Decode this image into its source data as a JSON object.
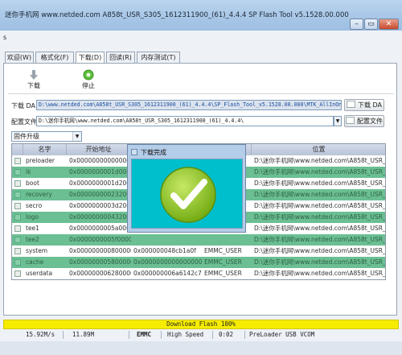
{
  "window": {
    "title": "迷你手机网 www.netded.com   A858t_USR_S305_1612311900_(61)_4.4.4  SP Flash Tool v5.1528.00.000",
    "menu_hint": "s"
  },
  "tabs": [
    {
      "label": "欢迎(W)"
    },
    {
      "label": "格式化(F)"
    },
    {
      "label": "下载(D)",
      "active": true
    },
    {
      "label": "回读(R)"
    },
    {
      "label": "内存测试(T)"
    }
  ],
  "toolbar": {
    "download_label": "下载",
    "stop_label": "停止"
  },
  "download_agent": {
    "label": "下载 DA",
    "path": "D:\\www.netded.com\\A858t_USR_S305_1612311900_(61)_4.4.4\\SP_Flash_Tool_v5.1528.00.000\\MTK_AllInOne_DA.bin",
    "button": "下载 DA"
  },
  "scatter": {
    "label": "配置文件",
    "path": "D:\\迷你手机网\\www.netded.com\\A858t_USR_S305_1612311900_(61)_4.4.4\\",
    "button": "配置文件"
  },
  "mode": {
    "selected": "固件升级"
  },
  "table": {
    "headers": [
      "名字",
      "开始地址",
      "",
      "",
      "位置"
    ],
    "rows": [
      {
        "name": "preloader",
        "start": "0x0000000000000000",
        "size": "",
        "region": "",
        "location": "D:\\迷你手机网\\www.netded.com\\A858t_USR_S3..."
      },
      {
        "name": "lk",
        "start": "0x0000000001d00000",
        "size": "",
        "region": "",
        "location": "D:\\迷你手机网\\www.netded.com\\A858t_USR_S3..."
      },
      {
        "name": "boot",
        "start": "0x0000000001d20000",
        "size": "",
        "region": "",
        "location": "D:\\迷你手机网\\www.netded.com\\A858t_USR_S3..."
      },
      {
        "name": "recovery",
        "start": "0x0000000002320000",
        "size": "",
        "region": "",
        "location": "D:\\迷你手机网\\www.netded.com\\A858t_USR_S3..."
      },
      {
        "name": "secro",
        "start": "0x0000000003d20000",
        "size": "",
        "region": "",
        "location": "D:\\迷你手机网\\www.netded.com\\A858t_USR_S3..."
      },
      {
        "name": "logo",
        "start": "0x0000000004320000",
        "size": "",
        "region": "",
        "location": "D:\\迷你手机网\\www.netded.com\\A858t_USR_S3..."
      },
      {
        "name": "tee1",
        "start": "0x0000000005a0000",
        "size": "",
        "region": "",
        "location": "D:\\迷你手机网\\www.netded.com\\A858t_USR_S3..."
      },
      {
        "name": "tee2",
        "start": "0x0000000005f00000",
        "size": "",
        "region": "",
        "location": "D:\\迷你手机网\\www.netded.com\\A858t_USR_S3..."
      },
      {
        "name": "system",
        "start": "0x0000000008000000",
        "size": "0x000000048cb1a0f",
        "region": "EMMC_USER",
        "location": "D:\\迷你手机网\\www.netded.com\\A858t_USR_S3..."
      },
      {
        "name": "cache",
        "start": "0x0000000058000000",
        "size": "0x0000000000000000",
        "region": "EMMC_USER",
        "location": "D:\\迷你手机网\\www.netded.com\\A858t_USR_S3..."
      },
      {
        "name": "userdata",
        "start": "0x0000000062800000",
        "size": "0x000000006a6142c7",
        "region": "EMMC_USER",
        "location": "D:\\迷你手机网\\www.netded.com\\A858t_USR_S3..."
      }
    ]
  },
  "dialog": {
    "title": "下载完成"
  },
  "progress": {
    "text": "Download Flash 100%",
    "percent": 100
  },
  "status": {
    "speed": "15.92M/s",
    "size": "11.89M",
    "storage": "EMMC",
    "usb_speed": "High Speed",
    "time": "0:02",
    "port": "PreLoader USB VCOM"
  },
  "colors": {
    "row_highlight": "#6bbf92",
    "progress": "#f5ec00",
    "dialog_body": "#00bfcd",
    "check_circle": "#8cc21a"
  }
}
